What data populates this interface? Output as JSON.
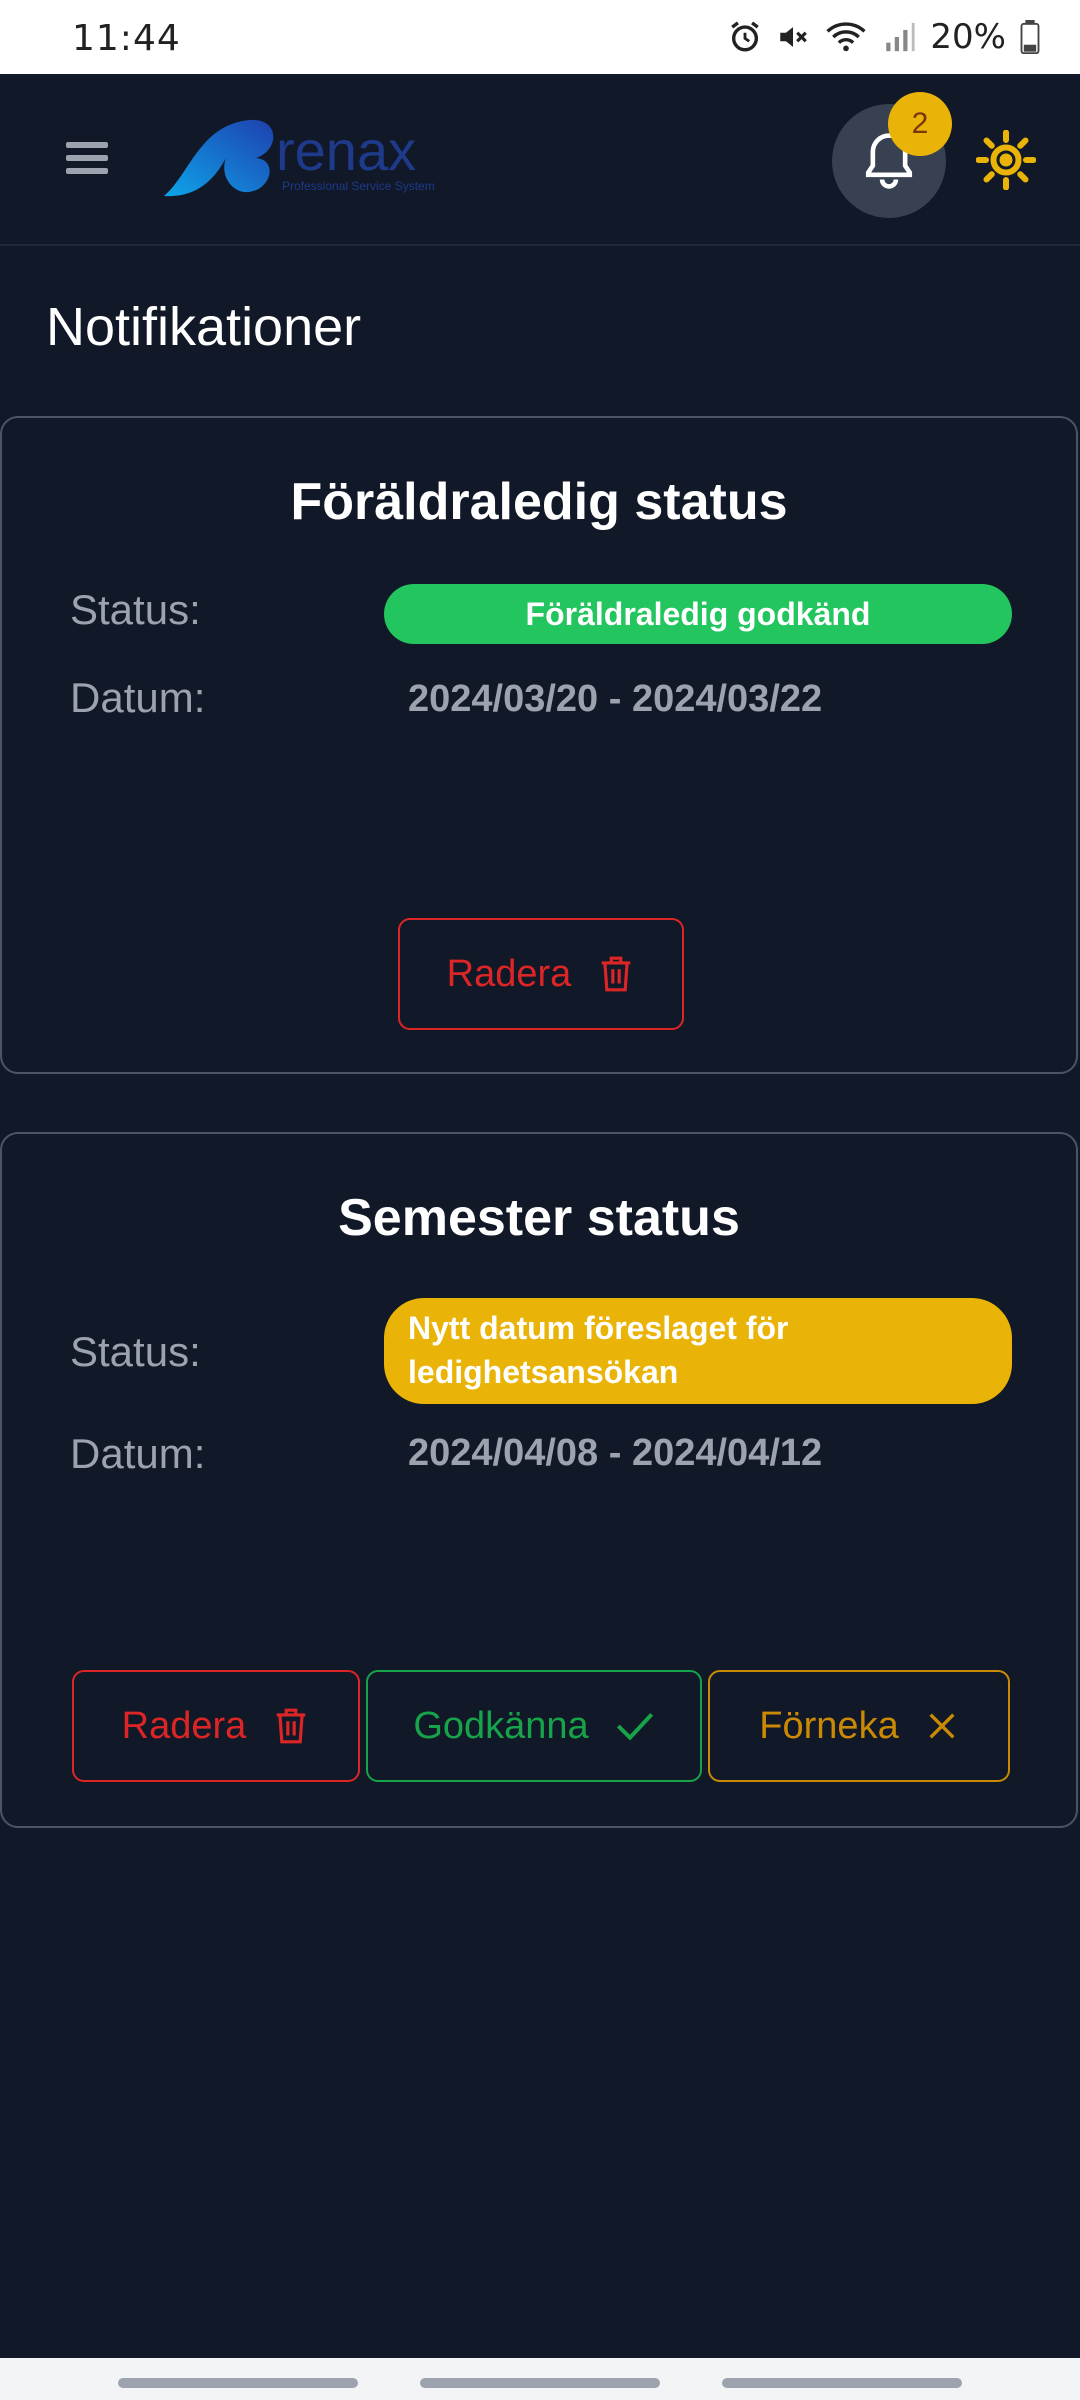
{
  "status_bar": {
    "time": "11:44",
    "battery": "20%"
  },
  "header": {
    "logo_text": "renax",
    "logo_tagline": "Professional Service System",
    "notification_count": "2"
  },
  "page": {
    "title": "Notifikationer"
  },
  "cards": [
    {
      "title": "Föräldraledig status",
      "status_label": "Status:",
      "status_value": "Föräldraledig godkänd",
      "date_label": "Datum:",
      "date_value": "2024/03/20 - 2024/03/22",
      "delete_label": "Radera"
    },
    {
      "title": "Semester status",
      "status_label": "Status:",
      "status_value": "Nytt datum föreslaget för ledighetsansökan",
      "date_label": "Datum:",
      "date_value": "2024/04/08 - 2024/04/12",
      "delete_label": "Radera",
      "approve_label": "Godkänna",
      "deny_label": "Förneka"
    }
  ],
  "colors": {
    "background": "#111827",
    "approved": "#22c55e",
    "pending": "#eab308",
    "danger": "#dc2626"
  }
}
